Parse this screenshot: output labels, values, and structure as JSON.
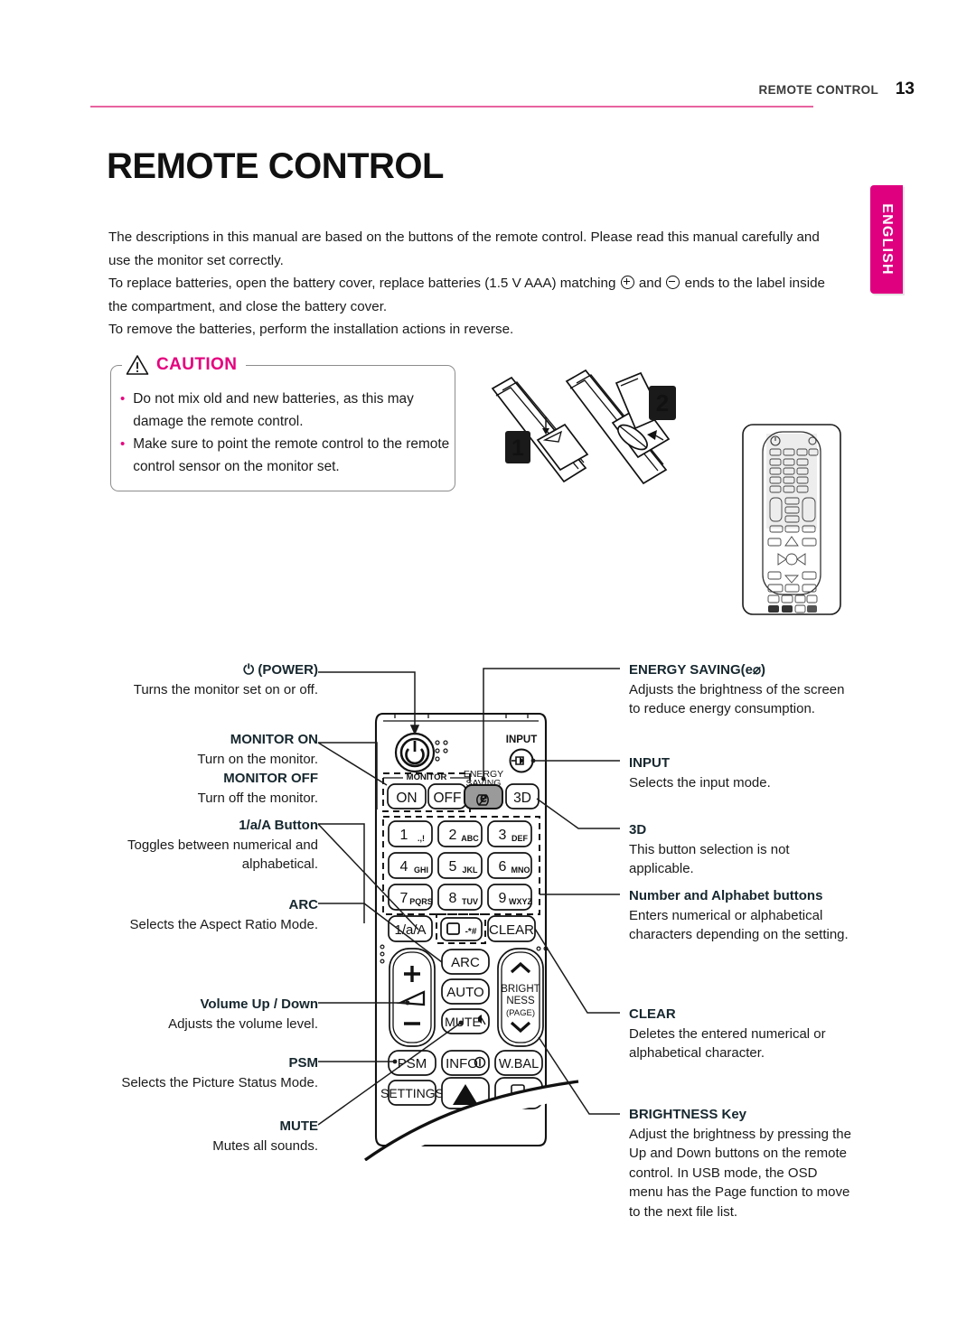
{
  "header": {
    "breadcrumb": "REMOTE CONTROL",
    "page_number": "13",
    "rule_color": "#e8629f"
  },
  "language_tab": {
    "label": "ENGLISH",
    "color": "#df0080"
  },
  "title": "REMOTE CONTROL",
  "intro": {
    "line1": "The descriptions in this manual are based on the buttons of the remote control. Please read this manual carefully and use the monitor set correctly.",
    "line2a": "To replace batteries, open the battery cover, replace batteries (1.5 V AAA) matching ",
    "line2b": " and ",
    "line2c": " ends to the label inside the compartment, and close the battery cover.",
    "line3": "To remove the batteries, perform the installation actions in reverse.",
    "plus_symbol": "plus-circle-icon",
    "minus_symbol": "minus-circle-icon"
  },
  "caution": {
    "label": "CAUTION",
    "icon": "warning-triangle-icon",
    "bullet": "•",
    "items": [
      "Do not mix old and new batteries, as this may damage the remote control.",
      "Make sure to point the remote control to the remote control sensor on the monitor set."
    ]
  },
  "battery_illustration": {
    "step1": "1",
    "step2": "2"
  },
  "annotations_left": [
    {
      "id": "power",
      "heading": "⏻ (POWER)",
      "body": "Turns the monitor set on or off."
    },
    {
      "id": "monitor-on",
      "heading": "MONITOR ON",
      "body": "Turn on the monitor."
    },
    {
      "id": "monitor-off",
      "heading": "MONITOR OFF",
      "body": "Turn off the monitor."
    },
    {
      "id": "one-a-A",
      "heading": "1/a/A Button",
      "body": "Toggles between numerical and alphabetical."
    },
    {
      "id": "arc",
      "heading": "ARC",
      "body": "Selects the Aspect Ratio Mode."
    },
    {
      "id": "volume",
      "heading": "Volume Up / Down",
      "body": "Adjusts the volume level."
    },
    {
      "id": "psm",
      "heading": "PSM",
      "body": "Selects the Picture Status Mode."
    },
    {
      "id": "mute",
      "heading": "MUTE",
      "body": "Mutes all sounds."
    }
  ],
  "annotations_right": [
    {
      "id": "energy-saving",
      "heading": "ENERGY SAVING(e⌀)",
      "body": "Adjusts the brightness of the screen to reduce energy consumption."
    },
    {
      "id": "input",
      "heading": "INPUT",
      "body": "Selects the input mode."
    },
    {
      "id": "3d",
      "heading": "3D",
      "body": "This button selection is not applicable."
    },
    {
      "id": "number-alphabet",
      "heading": "Number and Alphabet buttons",
      "body": "Enters numerical or alphabetical characters depending on the setting."
    },
    {
      "id": "clear",
      "heading": "CLEAR",
      "body": "Deletes the entered numerical or alphabetical character."
    },
    {
      "id": "brightness",
      "heading": "BRIGHTNESS Key",
      "body": "Adjust the brightness by pressing the Up and Down buttons on the remote control. In USB mode, the OSD menu has the Page function to move to the next file list."
    }
  ],
  "remote_buttons": {
    "power": "power-icon",
    "monitor_label": "MONITOR",
    "on": "ON",
    "off": "OFF",
    "energy_saving_label_l1": "ENERGY",
    "energy_saving_label_l2": "SAVING",
    "energy_saving_key": "e⌀",
    "threed": "3D",
    "input_label": "INPUT",
    "keys": [
      {
        "num": "1",
        "sub": "., !"
      },
      {
        "num": "2",
        "sub": "ABC"
      },
      {
        "num": "3",
        "sub": "DEF"
      },
      {
        "num": "4",
        "sub": "GHI"
      },
      {
        "num": "5",
        "sub": "JKL"
      },
      {
        "num": "6",
        "sub": "MNO"
      },
      {
        "num": "7",
        "sub": "PQRS"
      },
      {
        "num": "8",
        "sub": "TUV"
      },
      {
        "num": "9",
        "sub": "WXYZ"
      }
    ],
    "one_a_A": "1/a/A",
    "star_key": "-*#",
    "clear": "CLEAR",
    "arc": "ARC",
    "auto": "AUTO",
    "mute": "MUTE",
    "bright_l1": "BRIGHT",
    "bright_l2": "NESS",
    "bright_l3": "(PAGE)",
    "psm": "PSM",
    "info": "INFO",
    "wbal": "W.BAL",
    "settings": "SETTINGS",
    "volume_plus": "+",
    "volume_minus": "−"
  }
}
